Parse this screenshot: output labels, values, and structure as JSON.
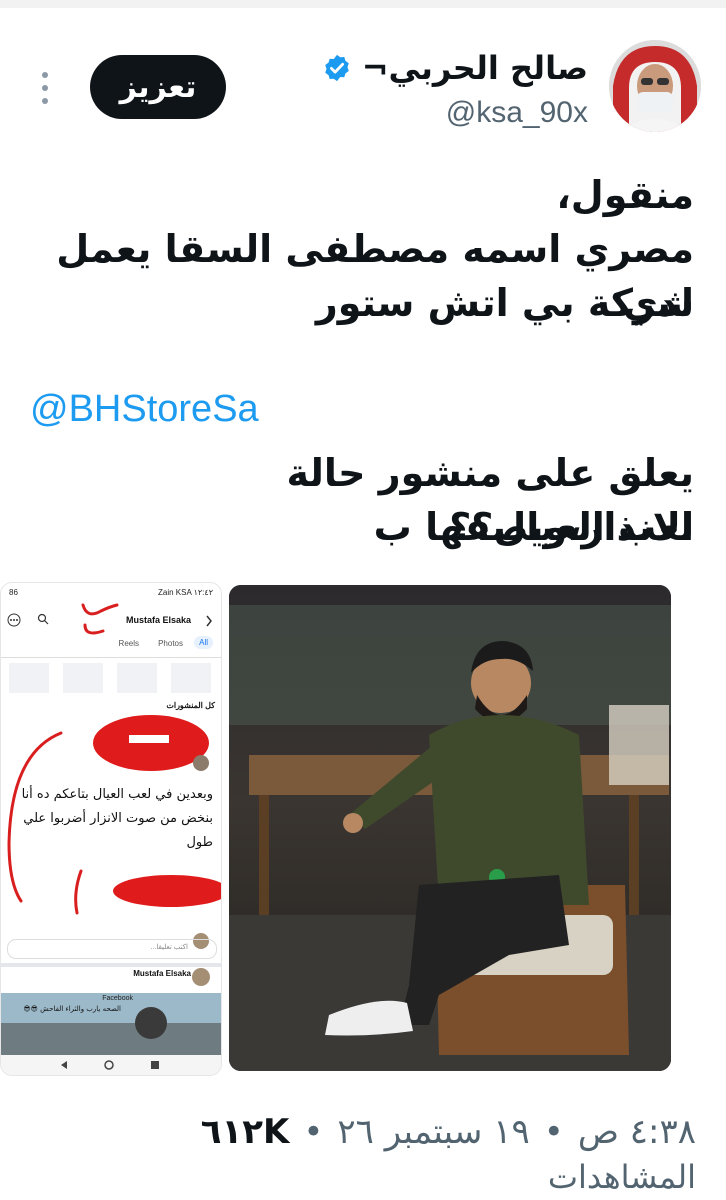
{
  "header": {
    "display_name": "صالح الحربي¬",
    "handle": "@ksa_90x",
    "boost_label": "تعزيز"
  },
  "tweet": {
    "line1": "منقول،",
    "line2": "مصري اسمه مصطفى السقا يعمل لدي",
    "line3": "شركة  بي اتش ستور",
    "mention": "@BHStoreSa",
    "line4": "يعلق على منشور حالة الانذار،ويصفها ب",
    "line5": "لعب العيال؟؟"
  },
  "screenshot": {
    "status_left": "Zain KSA ١٢:٤٢",
    "status_right": "86",
    "profile_name": "Mustafa Elsaka",
    "tabs": [
      "All",
      "Photos",
      "Reels"
    ],
    "posts_heading": "كل المنشورات",
    "comment_line1": "وبعدين في لعب العيال بتاعكم ده أنا",
    "comment_line2": "بنخض من صوت الانزار أضربوا علي",
    "comment_line3": "طول",
    "add_comment_placeholder": "اكتب تعليقا...",
    "second_post_name": "Mustafa Elsaka",
    "second_post_source": "Facebook",
    "second_post_caption": "الصحه يارب والثراء الفاحش 😎😎"
  },
  "footer": {
    "time": "٤:٣٨ ص",
    "date": "١٩ سبتمبر ٢٦",
    "views": "٦١٢K",
    "separator": "•",
    "views_label": "المشاهدات"
  },
  "colors": {
    "text": "#0f1419",
    "secondary": "#536471",
    "link": "#1d9bf0",
    "verified": "#1d9bf0",
    "button_bg": "#0f1419"
  }
}
